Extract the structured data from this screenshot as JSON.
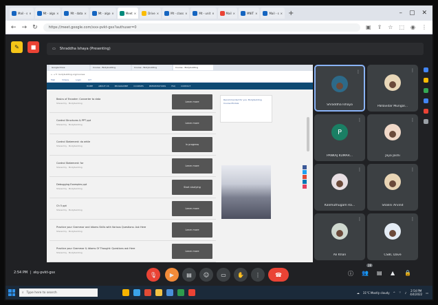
{
  "browser": {
    "tabs": [
      {
        "label": "Mail - s",
        "color": "#1565c0"
      },
      {
        "label": "Mt - algo",
        "color": "#1565c0"
      },
      {
        "label": "Mt - data",
        "color": "#1565c0"
      },
      {
        "label": "Mt - algo",
        "color": "#1565c0"
      },
      {
        "label": "Meet",
        "color": "#00897b",
        "active": true
      },
      {
        "label": "Drive",
        "color": "#fbbc04"
      },
      {
        "label": "Mt - class",
        "color": "#1565c0"
      },
      {
        "label": "Mt - unit",
        "color": "#1565c0"
      },
      {
        "label": "Mail",
        "color": "#ea4335"
      },
      {
        "label": "MNIT",
        "color": "#1565c0"
      },
      {
        "label": "Mail - s",
        "color": "#1565c0"
      }
    ],
    "new_tab": "+",
    "url": "https://meet.google.com/xxx-pvkt-gsx?authuser=0"
  },
  "meet": {
    "presenter_banner": "Shraddha Ishaya (Presenting)",
    "clock": "2:54 PM",
    "meeting_code": "xky-pvkt-gsx",
    "participants": [
      {
        "name": "Shraddha Ishaya",
        "initial": "",
        "bg": "#2d6a89",
        "highlight": true
      },
      {
        "name": "Pallavidar Mungal...",
        "initial": "",
        "bg": "#e8d7b8"
      },
      {
        "name": "PANKAJ KUMAR...",
        "initial": "P",
        "bg": "#1a7f64"
      },
      {
        "name": "Jaya Joshi",
        "initial": "",
        "bg": "#f0d8c8"
      },
      {
        "name": "Kalimuthugam Ra...",
        "initial": "",
        "bg": "#e8dfe3"
      },
      {
        "name": "Shalini Arvind",
        "initial": "",
        "bg": "#e9d5b5"
      },
      {
        "name": "Ali Khan",
        "initial": "",
        "bg": "#cfd8cf"
      },
      {
        "name": "CSBC Dave",
        "initial": "",
        "bg": "#e4ecf5"
      }
    ],
    "participant_count": "28"
  },
  "presented_page": {
    "inner_tabs": [
      "Google Drive",
      "Course - Bodybuilding",
      "Course - Bodybuilding",
      "Course - Bodybuilding"
    ],
    "bookmarks": [
      "Mail",
      "Videos",
      "Login",
      "ICT"
    ],
    "nav": [
      "HOME",
      "ABOUT US",
      "PROGRAMME",
      "COURSES",
      "PRESENTATIONS",
      "FAQ",
      "CONTACT"
    ],
    "items": [
      {
        "title": "Basics of Encoder: Converter to data",
        "meta": "Shared by · Bodybuilding",
        "button": "Learn more"
      },
      {
        "title": "Control Structures & PPT ppt",
        "meta": "Shared by · Bodybuilding",
        "button": "Learn more"
      },
      {
        "title": "Control Statement: do while",
        "meta": "Shared by · Bodybuilding",
        "button": "In progress"
      },
      {
        "title": "Control Statement: for",
        "meta": "Shared by · Bodybuilding",
        "button": "Learn more"
      },
      {
        "title": "Debugging Examples ppt",
        "meta": "Shared by · Bodybuilding",
        "button": "Start studying"
      },
      {
        "title": "Ch 5 ppt",
        "meta": "Shared by · Bodybuilding",
        "button": "Learn more"
      },
      {
        "title": "Practice your Grammar and Idioms Skills with Various Questions: Ask Here",
        "meta": "Shared by · Bodybuilding",
        "button": "Learn more"
      },
      {
        "title": "Practice your Grammar & Idioms Of Thought: Questions ask Here",
        "meta": "Shared by · Bodybuilding",
        "button": "Learn more"
      }
    ],
    "side_text": "Recommended for you: Bodybuilding Course Module"
  },
  "taskbar": {
    "search_placeholder": "Type here to search",
    "weather": "31°C Mostly cloudy",
    "time": "2:54 PM",
    "date": "4/4/2022"
  }
}
